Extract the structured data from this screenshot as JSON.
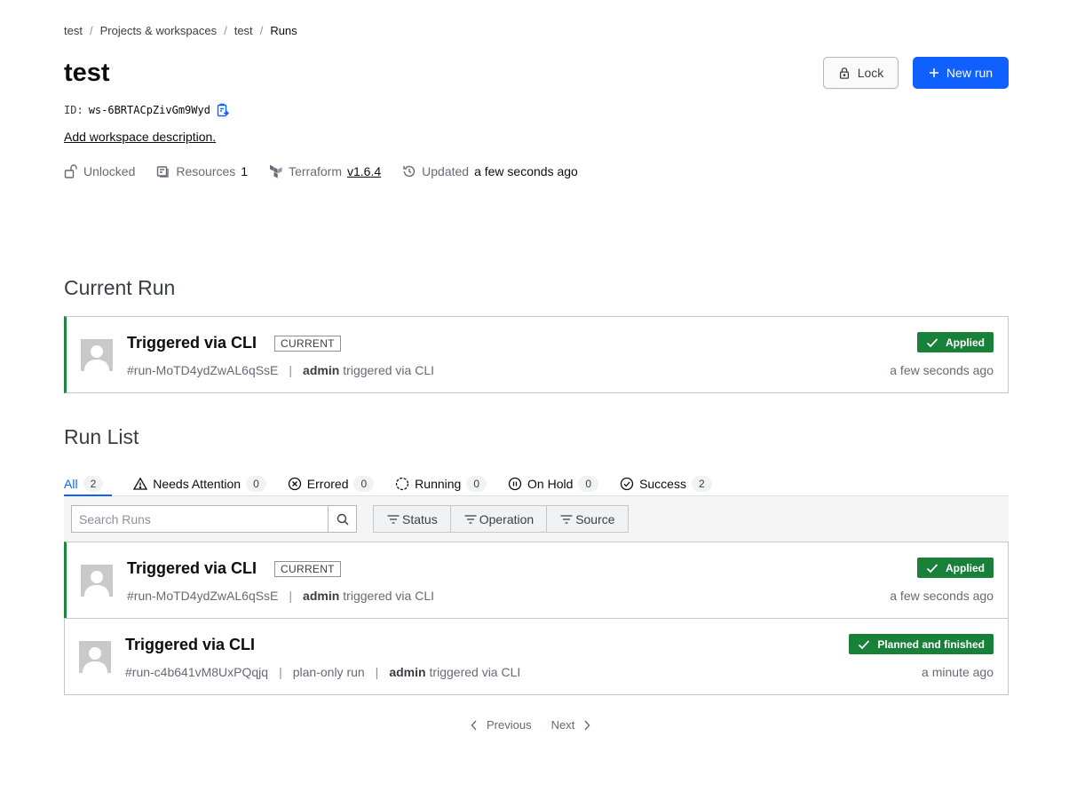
{
  "breadcrumb": {
    "items": [
      "test",
      "Projects & workspaces",
      "test",
      "Runs"
    ],
    "separator": "/"
  },
  "workspace": {
    "title": "test",
    "id_label": "ID:",
    "id_value": "ws-6BRTACpZivGm9Wyd",
    "add_description": "Add workspace description.",
    "lock_status": "Unlocked",
    "resources_label": "Resources",
    "resources_count": "1",
    "terraform_label": "Terraform",
    "terraform_version": "v1.6.4",
    "updated_label": "Updated",
    "updated_value": "a few seconds ago"
  },
  "actions": {
    "lock_label": "Lock",
    "new_run_label": "New run"
  },
  "current_run_section": {
    "title": "Current Run",
    "run": {
      "title": "Triggered via CLI",
      "badge": "CURRENT",
      "run_id": "#run-MoTD4ydZwAL6qSsE",
      "user": "admin",
      "trigger_text": "triggered via CLI",
      "status": "Applied",
      "time": "a few seconds ago"
    }
  },
  "run_list_section": {
    "title": "Run List",
    "tabs": [
      {
        "label": "All",
        "count": "2",
        "icon": "none"
      },
      {
        "label": "Needs Attention",
        "count": "0",
        "icon": "warning-icon"
      },
      {
        "label": "Errored",
        "count": "0",
        "icon": "x-circle-icon"
      },
      {
        "label": "Running",
        "count": "0",
        "icon": "running-icon"
      },
      {
        "label": "On Hold",
        "count": "0",
        "icon": "pause-circle-icon"
      },
      {
        "label": "Success",
        "count": "2",
        "icon": "check-circle-icon"
      }
    ],
    "search_placeholder": "Search Runs",
    "filters": [
      "Status",
      "Operation",
      "Source"
    ],
    "runs": [
      {
        "title": "Triggered via CLI",
        "badge": "CURRENT",
        "run_id": "#run-MoTD4ydZwAL6qSsE",
        "user": "admin",
        "trigger_text": "triggered via CLI",
        "status": "Applied",
        "time": "a few seconds ago"
      },
      {
        "title": "Triggered via CLI",
        "run_id": "#run-c4b641vM8UxPQqjq",
        "plan_only": "plan-only run",
        "user": "admin",
        "trigger_text": "triggered via CLI",
        "status": "Planned and finished",
        "time": "a minute ago"
      }
    ]
  },
  "pagination": {
    "previous": "Previous",
    "next": "Next"
  },
  "colors": {
    "primary": "#1060ff",
    "success": "#198039",
    "current_border": "#1a8a3a"
  }
}
